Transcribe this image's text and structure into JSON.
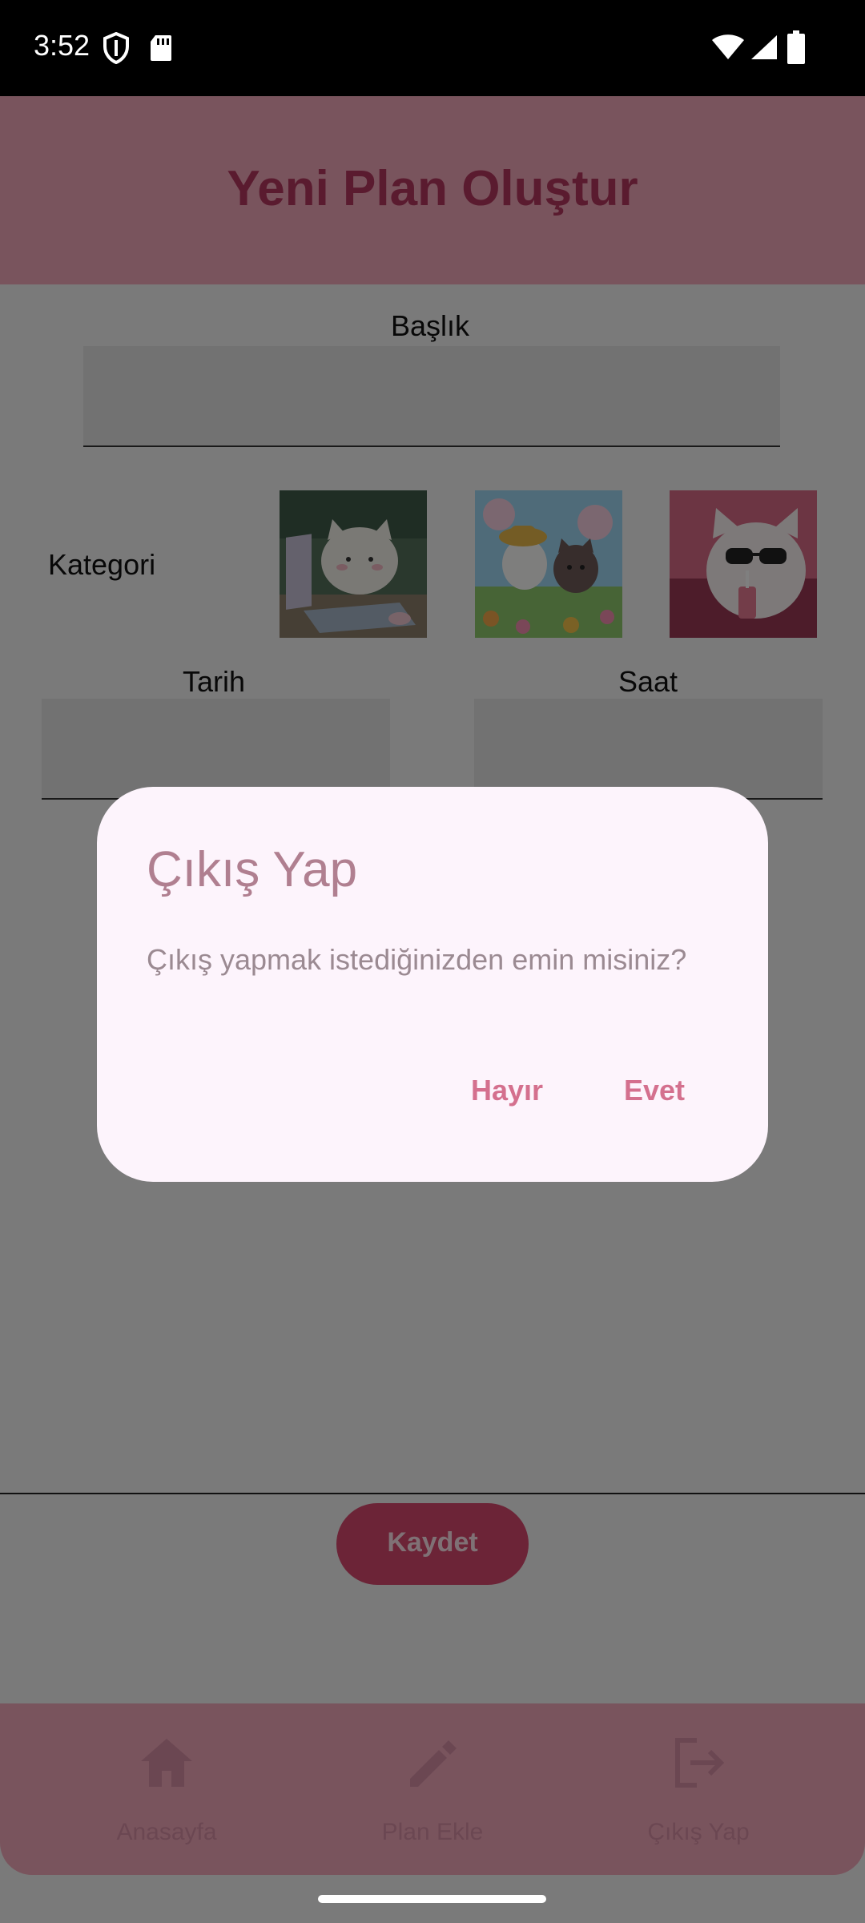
{
  "status_bar": {
    "time": "3:52"
  },
  "app_bar": {
    "title": "Yeni Plan Oluştur"
  },
  "form": {
    "title_label": "Başlık",
    "title_value": "",
    "category_label": "Kategori",
    "date_label": "Tarih",
    "date_value": "",
    "time_label": "Saat",
    "time_value": "",
    "categories": [
      {
        "icon": "cat-at-computer-image"
      },
      {
        "icon": "cats-in-garden-image"
      },
      {
        "icon": "cat-with-sunglasses-image"
      }
    ]
  },
  "save_button": {
    "label": "Kaydet"
  },
  "bottom_nav": {
    "items": [
      {
        "label": "Anasayfa",
        "icon": "home-icon"
      },
      {
        "label": "Plan Ekle",
        "icon": "pencil-icon"
      },
      {
        "label": "Çıkış Yap",
        "icon": "logout-icon"
      }
    ]
  },
  "dialog": {
    "title": "Çıkış Yap",
    "message": "Çıkış yapmak istediğinizden emin misiniz?",
    "cancel_label": "Hayır",
    "confirm_label": "Evet"
  },
  "colors": {
    "accent": "#f3a9bb",
    "title_text": "#b5365f",
    "button": "#d9496f",
    "dialog_button_text": "#d4708e",
    "dialog_background": "#fdf4fc"
  }
}
